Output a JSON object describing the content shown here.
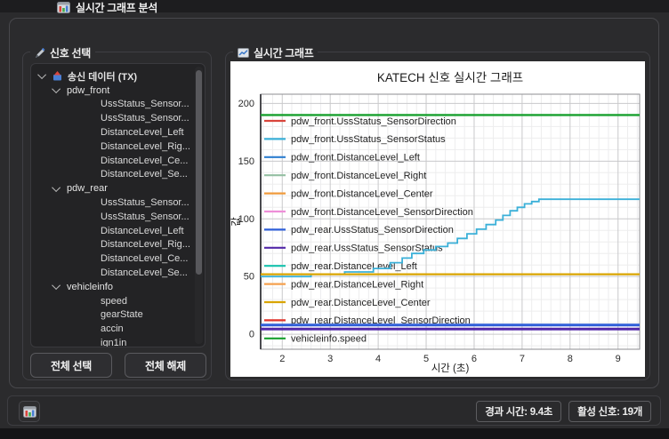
{
  "window": {
    "title": "실시간 그래프 분석"
  },
  "signal_panel": {
    "title": "신호 선택",
    "tree": [
      {
        "label": "송신 데이터 (TX)",
        "level": 0,
        "chevron": true,
        "icon": "tx-data-icon"
      },
      {
        "label": "pdw_front",
        "level": 1,
        "chevron": true
      },
      {
        "label": "UssStatus_Sensor...",
        "level": 2
      },
      {
        "label": "UssStatus_Sensor...",
        "level": 2
      },
      {
        "label": "DistanceLevel_Left",
        "level": 2
      },
      {
        "label": "DistanceLevel_Rig...",
        "level": 2
      },
      {
        "label": "DistanceLevel_Ce...",
        "level": 2
      },
      {
        "label": "DistanceLevel_Se...",
        "level": 2
      },
      {
        "label": "pdw_rear",
        "level": 1,
        "chevron": true
      },
      {
        "label": "UssStatus_Sensor...",
        "level": 2
      },
      {
        "label": "UssStatus_Sensor...",
        "level": 2
      },
      {
        "label": "DistanceLevel_Left",
        "level": 2
      },
      {
        "label": "DistanceLevel_Rig...",
        "level": 2
      },
      {
        "label": "DistanceLevel_Ce...",
        "level": 2
      },
      {
        "label": "DistanceLevel_Se...",
        "level": 2
      },
      {
        "label": "vehicleinfo",
        "level": 1,
        "chevron": true
      },
      {
        "label": "speed",
        "level": 2
      },
      {
        "label": "gearState",
        "level": 2
      },
      {
        "label": "accin",
        "level": 2
      },
      {
        "label": "ign1in",
        "level": 2
      }
    ],
    "buttons": {
      "select_all": "전체 선택",
      "deselect_all": "전체 해제"
    }
  },
  "graph_panel": {
    "title": "실시간 그래프"
  },
  "chart_data": {
    "type": "line",
    "title": "KATECH 신호 실시간 그래프",
    "xlabel": "시간 (초)",
    "ylabel": "값",
    "xlim": [
      1.55,
      9.45
    ],
    "ylim": [
      -13,
      208
    ],
    "xticks": [
      2,
      3,
      4,
      5,
      6,
      7,
      8,
      9
    ],
    "yticks": [
      0,
      50,
      100,
      150,
      200
    ],
    "minor_grid": true,
    "legend_position": "upper-left",
    "series": [
      {
        "name": "pdw_front.UssStatus_SensorDirection",
        "color": "#d9453c",
        "width": 2,
        "points": null
      },
      {
        "name": "pdw_front.UssStatus_SensorStatus",
        "color": "#3bb0d8",
        "width": 1.8,
        "points": [
          [
            1.55,
            50
          ],
          [
            2.6,
            50
          ],
          [
            2.6,
            52
          ],
          [
            3.3,
            52
          ],
          [
            3.3,
            54
          ],
          [
            3.9,
            54
          ],
          [
            3.9,
            57
          ],
          [
            4.25,
            57
          ],
          [
            4.25,
            62
          ],
          [
            4.5,
            62
          ],
          [
            4.5,
            66
          ],
          [
            4.7,
            66
          ],
          [
            4.7,
            70
          ],
          [
            4.95,
            70
          ],
          [
            4.95,
            73
          ],
          [
            5.2,
            73
          ],
          [
            5.2,
            76
          ],
          [
            5.45,
            76
          ],
          [
            5.45,
            79
          ],
          [
            5.65,
            79
          ],
          [
            5.65,
            83
          ],
          [
            5.85,
            83
          ],
          [
            5.85,
            87
          ],
          [
            6.05,
            87
          ],
          [
            6.05,
            91
          ],
          [
            6.25,
            91
          ],
          [
            6.25,
            95
          ],
          [
            6.45,
            95
          ],
          [
            6.45,
            99
          ],
          [
            6.6,
            99
          ],
          [
            6.6,
            103
          ],
          [
            6.75,
            103
          ],
          [
            6.75,
            107
          ],
          [
            6.9,
            107
          ],
          [
            6.9,
            110
          ],
          [
            7.05,
            110
          ],
          [
            7.05,
            113
          ],
          [
            7.2,
            113
          ],
          [
            7.2,
            115
          ],
          [
            7.35,
            115
          ],
          [
            7.35,
            117
          ],
          [
            9.45,
            117
          ]
        ]
      },
      {
        "name": "pdw_front.DistanceLevel_Left",
        "color": "#2e7fd0",
        "width": 2,
        "points": null
      },
      {
        "name": "pdw_front.DistanceLevel_Right",
        "color": "#94bfa2",
        "width": 2,
        "points": null
      },
      {
        "name": "pdw_front.DistanceLevel_Center",
        "color": "#f09b3d",
        "width": 2,
        "points": null
      },
      {
        "name": "pdw_front.DistanceLevel_SensorDirection",
        "color": "#ee8fd8",
        "width": 2,
        "points": null
      },
      {
        "name": "pdw_rear.UssStatus_SensorDirection",
        "color": "#2f5fd9",
        "width": 3,
        "points": [
          [
            1.55,
            8
          ],
          [
            9.45,
            8
          ]
        ]
      },
      {
        "name": "pdw_rear.UssStatus_SensorStatus",
        "color": "#5328a8",
        "width": 3,
        "points": [
          [
            1.55,
            4.5
          ],
          [
            9.45,
            4.5
          ]
        ]
      },
      {
        "name": "pdw_rear.DistanceLevel_Left",
        "color": "#17c3ae",
        "width": 2.2,
        "points": null
      },
      {
        "name": "pdw_rear.DistanceLevel_Right",
        "color": "#f5a14f",
        "width": 2,
        "points": null
      },
      {
        "name": "pdw_rear.DistanceLevel_Center",
        "color": "#d9a400",
        "width": 2.2,
        "points": [
          [
            1.55,
            52
          ],
          [
            9.45,
            52
          ]
        ]
      },
      {
        "name": "pdw_rear.DistanceLevel_SensorDirection",
        "color": "#e0322a",
        "width": 2,
        "points": null
      },
      {
        "name": "vehicleinfo.speed",
        "color": "#18a02e",
        "width": 2.4,
        "points": [
          [
            1.55,
            190
          ],
          [
            9.45,
            190
          ]
        ]
      }
    ]
  },
  "status_bar": {
    "elapsed": "경과 시간: 9.4초",
    "active_signals": "활성 신호: 19개"
  }
}
